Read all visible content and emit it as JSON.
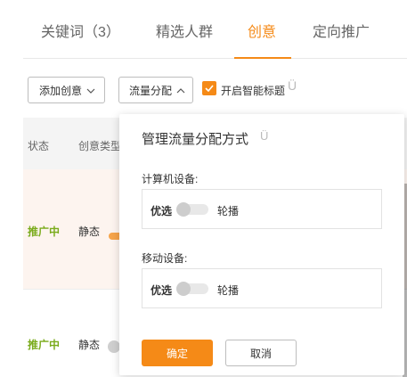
{
  "tabs": [
    {
      "label": "关键词（3）",
      "active": false
    },
    {
      "label": "精选人群",
      "active": false
    },
    {
      "label": "创意",
      "active": true
    },
    {
      "label": "定向推广",
      "active": false
    }
  ],
  "toolbar": {
    "add_label": "添加创意",
    "flow_label": "流量分配",
    "smart_title_label": "开启智能标题",
    "smart_title_checked": true
  },
  "table": {
    "headers": [
      "状态",
      "创意类型"
    ],
    "rows": [
      {
        "status": "推广中",
        "type": "静态"
      },
      {
        "status": "推广中",
        "type": "静态"
      }
    ]
  },
  "popup": {
    "title": "管理流量分配方式",
    "sections": [
      {
        "label": "计算机设备:",
        "left": "优选",
        "right": "轮播"
      },
      {
        "label": "移动设备:",
        "left": "优选",
        "right": "轮播"
      }
    ],
    "confirm": "确定",
    "cancel": "取消"
  },
  "colors": {
    "accent": "#f58a17",
    "status_green": "#7aab1c"
  },
  "icons": [
    "chevron-down-icon",
    "chevron-up-icon",
    "check-icon",
    "help-icon"
  ]
}
